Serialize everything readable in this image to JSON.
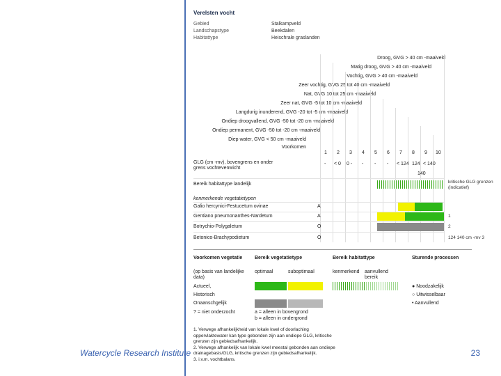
{
  "footer": {
    "org": "Watercycle Research Institute",
    "page": "23"
  },
  "doc": {
    "title": "Verelsten vocht",
    "meta": [
      {
        "k": "Gebied",
        "v": "Stalkampveld"
      },
      {
        "k": "Landschapstype",
        "v": "Beekdalen"
      },
      {
        "k": "Habitattype",
        "v": "Heischrale graslanden"
      }
    ],
    "diagonals": [
      "Droog, GVG > 40 cm -maaiveld",
      "Matig droog, GVG > 40 cm -maaiveld",
      "Vochtig, GVG > 40 cm -maaiveld",
      "Zeer vochtig, GVG 25 tot 40 cm -maaiveld",
      "Nat, GVG 10 tot 25 cm -maaiveld",
      "Zeer nat, GVG -5 tot 10 cm -maaiveld",
      "Langdurig inunderend, GVG -20 tot -5 cm -maaiveld",
      "Ondiep droogvallend, GVG -50 tot -20 cm -maaiveld",
      "Ondiep permanent, GVG -50 tot -20 cm -maaiveld",
      "Diep water, GVG < 50 cm -maaiveld",
      "Voorkomen"
    ],
    "cols": [
      "1",
      "2",
      "3",
      "4",
      "5",
      "6",
      "7",
      "8",
      "9",
      "10"
    ],
    "glg_label": "GLG (cm -mv), bovengrens en onder grens vochtevenwicht",
    "glg_vals": [
      "-",
      "< 0",
      "0 -",
      "-",
      "-",
      "-",
      "< 124",
      "124",
      "< 140"
    ],
    "glg_extra": "140",
    "bereik_label": "Bereik habitattype landelijk",
    "bereik_note": "kritische GLG grenzen (indicatief)",
    "veg_section": "kenmerkende vegetatietypen",
    "rows": [
      {
        "label": "Galio hercynici-Festucetum ovinae",
        "code": "A",
        "note": ""
      },
      {
        "label": "Gentiano pneumonanthes-Nardetum",
        "code": "A",
        "note": "1"
      },
      {
        "label": "Botrychio-Polygaletum",
        "code": "O",
        "note": "2"
      },
      {
        "label": "Betonico-Brachypodietum",
        "code": "O",
        "note": "124 140 cm -mv 3"
      }
    ],
    "legend": {
      "h1": "Voorkomen vegetatie",
      "h1b": "(op basis van landelijke data)",
      "h2": "Bereik vegetatietype",
      "h3": "Bereik habitattype",
      "h4": "Sturende processen",
      "optimaal": "optimaal",
      "suboptimaal": "suboptimaal",
      "kenmerk": "kenmerkend",
      "aanvullend": "aanvullend bereik",
      "actueel": "Actueel,",
      "historisch": "Historisch",
      "onaanschgelijk": "Onaanschgelijk",
      "onderzoek": "? = niet onderzocht",
      "bovengrond": "a = alleen in bovengrond",
      "ondergrond": "b = alleen in ondergrond",
      "p1": "Noodzakelijk",
      "p2": "Uitwisselbaar",
      "p3": "Aanvullend"
    },
    "footnotes": [
      "1. Verwege afhankelijkheid van lokale kwel of doorlaching",
      "oppervlaktewater kan type gebonden zijn aan ondiepe GLG, kritische",
      "grenzen zijn gebiedsafhankelijk.",
      "2. Verwege afhankelijk van lokale kwel meestal gebonden aan ondiepe",
      "drainagebasis/GLG, kritische grenzen zijn gebiedsafhankelijk.",
      "3. i.v.m. vochtbalans."
    ]
  }
}
